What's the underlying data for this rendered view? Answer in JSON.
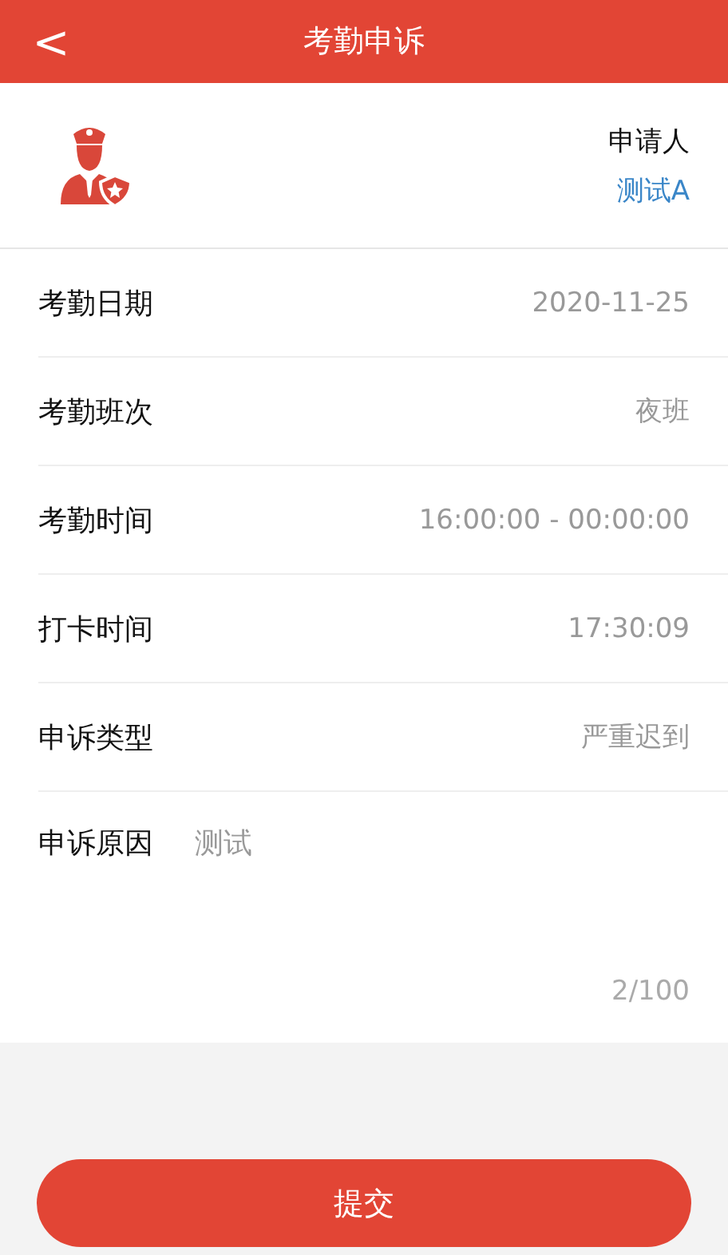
{
  "header": {
    "back": "<",
    "title": "考勤申诉"
  },
  "applicant": {
    "label": "申请人",
    "name": "测试A"
  },
  "rows": [
    {
      "label": "考勤日期",
      "value": "2020-11-25"
    },
    {
      "label": "考勤班次",
      "value": "夜班"
    },
    {
      "label": "考勤时间",
      "value": "16:00:00 - 00:00:00"
    },
    {
      "label": "打卡时间",
      "value": "17:30:09"
    },
    {
      "label": "申诉类型",
      "value": "严重迟到"
    }
  ],
  "reason": {
    "label": "申诉原因",
    "value": "测试",
    "counter": "2/100"
  },
  "submit": "提交"
}
